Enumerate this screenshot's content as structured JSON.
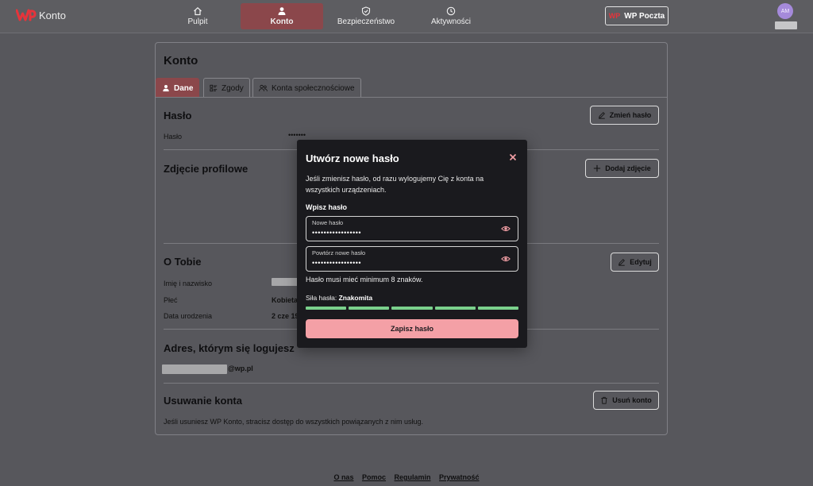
{
  "app": {
    "logo_text": "Konto"
  },
  "nav": {
    "items": [
      {
        "label": "Pulpit",
        "icon": "home-icon"
      },
      {
        "label": "Konto",
        "icon": "user-icon",
        "active": true
      },
      {
        "label": "Bezpieczeństwo",
        "icon": "shield-icon"
      },
      {
        "label": "Aktywności",
        "icon": "clock-icon"
      }
    ],
    "mail_button": "WP Poczta",
    "mail_logo": "WP",
    "avatar_initials": "AM"
  },
  "page": {
    "title": "Konto",
    "tabs": [
      {
        "label": "Dane",
        "active": true,
        "icon": "user-icon"
      },
      {
        "label": "Zgody",
        "icon": "list-icon"
      },
      {
        "label": "Konta społecznościowe",
        "icon": "users-icon"
      }
    ]
  },
  "password_section": {
    "title": "Hasło",
    "label": "Hasło",
    "value": "•••••••",
    "change_button": "Zmień hasło"
  },
  "photo_section": {
    "title": "Zdjęcie profilowe",
    "add_button": "Dodaj zdjęcie"
  },
  "about_section": {
    "title": "O Tobie",
    "edit_button": "Edytuj",
    "rows": [
      {
        "label": "Imię i nazwisko",
        "value": ""
      },
      {
        "label": "Płeć",
        "value": "Kobieta"
      },
      {
        "label": "Data urodzenia",
        "value": "2 cze 19"
      }
    ]
  },
  "login_section": {
    "title": "Adres, którym się logujesz",
    "email_suffix": "@wp.pl"
  },
  "delete_section": {
    "title": "Usuwanie konta",
    "button": "Usuń konto",
    "description": "Jeśli usuniesz WP Konto, stracisz dostęp do wszystkich powiązanych z nim usług."
  },
  "modal": {
    "title": "Utwórz nowe hasło",
    "description": "Jeśli zmienisz hasło, od razu wylogujemy Cię z konta na wszystkich urządzeniach.",
    "subtitle": "Wpisz hasło",
    "new_password": {
      "label": "Nowe hasło",
      "value": "•••••••••••••••••"
    },
    "repeat_password": {
      "label": "Powtórz nowe hasło",
      "value": "•••••••••••••••••"
    },
    "hint": "Hasło musi mieć minimum 8 znaków.",
    "strength_label": "Siła hasła:",
    "strength_value": "Znakomita",
    "strength_level": 1.0,
    "strength_color": "#7ad08c",
    "save_button": "Zapisz hasło"
  },
  "footer": {
    "links": [
      "O nas",
      "Pomoc",
      "Regulamin",
      "Prywatność"
    ]
  },
  "colors": {
    "background": "#57575c",
    "accent_active": "#8b474b",
    "modal_bg": "#1a1a1e",
    "save_button": "#f4a0a6",
    "brand_red": "#e5343b"
  }
}
